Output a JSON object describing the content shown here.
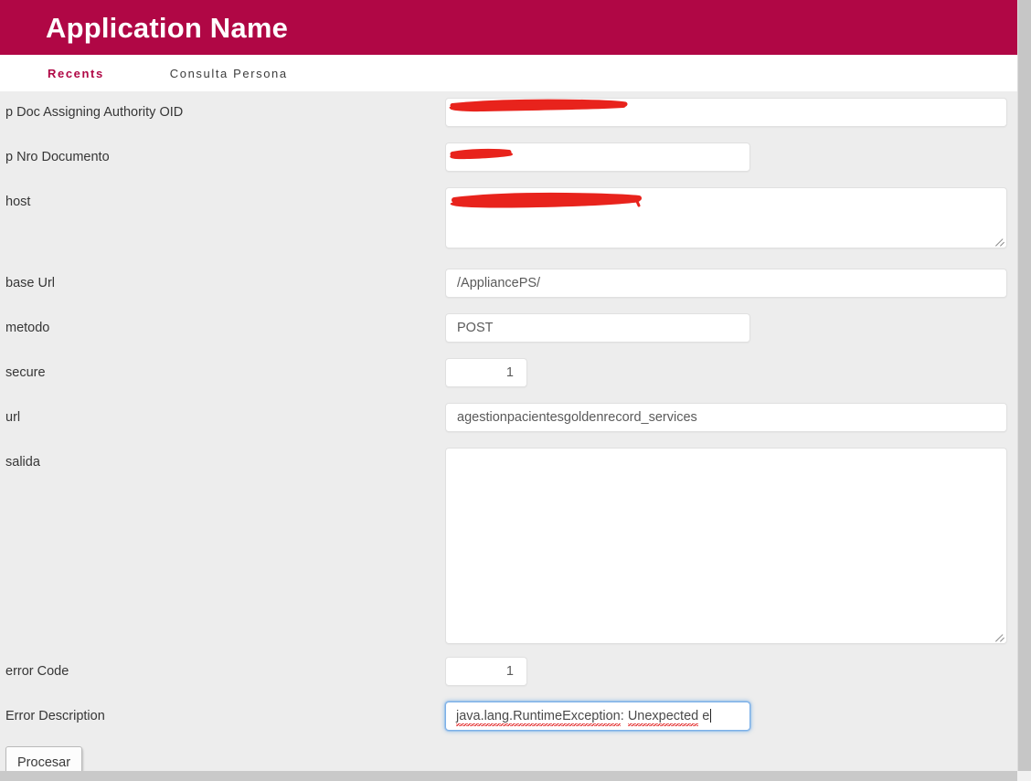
{
  "header": {
    "title": "Application Name",
    "background_color": "#b00745",
    "title_color": "#ffffff"
  },
  "tabs": [
    {
      "label": "Recents",
      "active": true,
      "color": "#b00745"
    },
    {
      "label": "Consulta Persona",
      "active": false,
      "color": "#3c3c3c"
    }
  ],
  "form": {
    "fields": [
      {
        "label": "p Doc Assigning Authority OID",
        "value": "",
        "redacted": true,
        "control": "text"
      },
      {
        "label": "p Nro Documento",
        "value": "",
        "redacted": true,
        "control": "text"
      },
      {
        "label": "host",
        "value": "",
        "redacted": true,
        "control": "textarea"
      },
      {
        "label": "base Url",
        "value": "/AppliancePS/",
        "redacted": false,
        "control": "text"
      },
      {
        "label": "metodo",
        "value": "POST",
        "redacted": false,
        "control": "text"
      },
      {
        "label": "secure",
        "value": "1",
        "redacted": false,
        "control": "number"
      },
      {
        "label": "url",
        "value": "agestionpacientesgoldenrecord_services",
        "redacted": false,
        "control": "text"
      },
      {
        "label": "salida",
        "value": "",
        "redacted": false,
        "control": "textarea"
      },
      {
        "label": "error Code",
        "value": "1",
        "redacted": false,
        "control": "number"
      },
      {
        "label": "Error Description",
        "value": "java.lang.RuntimeException: Unexpected e",
        "redacted": false,
        "control": "text",
        "focused": true,
        "spellcheck_words": [
          "java.lang.RuntimeException",
          "Unexpected"
        ]
      }
    ],
    "submit_button": "Procesar"
  },
  "colors": {
    "page_background": "#ededed",
    "field_background": "#ffffff",
    "field_border": "#e0e0e0",
    "focus_ring": "#7cb0e8",
    "redaction_marker": "#e8231c",
    "spellcheck_underline": "#e01b1b"
  }
}
